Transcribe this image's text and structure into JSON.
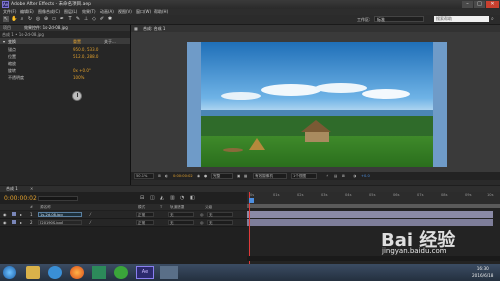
{
  "window": {
    "title": "Adobe After Effects - 未命名项目.aep",
    "min": "–",
    "max": "□",
    "close": "✕",
    "app_badge": "Ae"
  },
  "menu": [
    "文件(F)",
    "编辑(E)",
    "图像合成(C)",
    "图层(L)",
    "效果(T)",
    "动画(A)",
    "视图(V)",
    "窗口(W)",
    "帮助(H)"
  ],
  "toolbar": {
    "workspace_label": "工作区:",
    "workspace_value": "标准",
    "search_placeholder": "搜索帮助"
  },
  "left_panel": {
    "tab_project": "项目",
    "tab_effects": "效果控件: 1s-2d-08.jpg",
    "layer_path": "合成 1 • 1s-2d-08.jpg",
    "transform": "变换",
    "reset": "重置",
    "about": "关于...",
    "anchor_label": "锚点",
    "anchor_value": "950.0, 533.0",
    "position_label": "位置",
    "position_value": "512.0, 288.0",
    "scale_label": "缩放",
    "rotation_label": "旋转",
    "rotation_value": "0x +0.0°",
    "opacity_label": "不透明度",
    "opacity_value": "100%"
  },
  "comp_panel": {
    "tab": "合成: 合成 1",
    "zoom": "50.1%",
    "timecode": "0:00:00:02",
    "quality": "完整",
    "camera": "有效摄像机",
    "views": "1个视图",
    "exposure": "+0.0"
  },
  "timeline": {
    "tab": "合成 1",
    "timecode": "0:00:00:02",
    "columns": [
      "#",
      "源名称",
      "模式",
      "T",
      "轨道遮罩",
      "父级"
    ],
    "layers": [
      {
        "num": "1",
        "name": "1s-2d-08.jpg",
        "mode": "正常",
        "track": "无",
        "parent": "无"
      },
      {
        "num": "2",
        "name": "[20190S.jpg]",
        "mode": "正常",
        "track": "无",
        "parent": "无"
      }
    ],
    "ruler": [
      "0s",
      "01s",
      "02s",
      "03s",
      "04s",
      "05s",
      "06s",
      "07s",
      "08s",
      "09s",
      "10s"
    ]
  },
  "taskbar": {
    "time": "16:30",
    "date": "2016/6/18"
  },
  "watermark": {
    "brand": "Bai  经验",
    "url": "jingyan.baidu.com"
  },
  "colors": {
    "accent_orange": "#e3a12d",
    "layer_bar": "#8a8aa6",
    "playhead": "#e03a3a"
  }
}
